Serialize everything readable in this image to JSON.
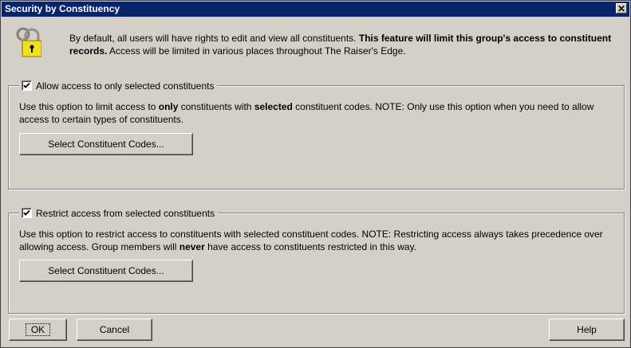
{
  "window": {
    "title": "Security by Constituency",
    "close_label": "✕"
  },
  "intro": {
    "part1": "By default, all users will have rights to edit and view all constituents. ",
    "bold": "This feature will limit this group's access to constituent records.",
    "part2": " Access will be limited in various places throughout The Raiser's Edge."
  },
  "allow_group": {
    "checkbox_label": "Allow access to only selected constituents",
    "checked": true,
    "desc_part1": "Use this option to limit access to ",
    "desc_bold1": "only",
    "desc_part2": " constituents with ",
    "desc_bold2": "selected",
    "desc_part3": " constituent codes.  NOTE: Only use this option when you need to allow access to certain types of constituents.",
    "button_label": "Select Constituent Codes..."
  },
  "restrict_group": {
    "checkbox_label": "Restrict access from selected constituents",
    "checked": true,
    "desc_part1": "Use this option to restrict access to constituents with selected constituent codes.  NOTE: Restricting access always takes precedence over allowing access.  Group members will ",
    "desc_bold": "never",
    "desc_part2": " have access to constituents restricted in this way.",
    "button_label": "Select Constituent Codes..."
  },
  "footer": {
    "ok_label": "OK",
    "cancel_label": "Cancel",
    "help_label": "Help"
  },
  "icons": {
    "lock": "padlock-keys-icon",
    "close": "close-icon",
    "check": "checkmark-icon"
  }
}
